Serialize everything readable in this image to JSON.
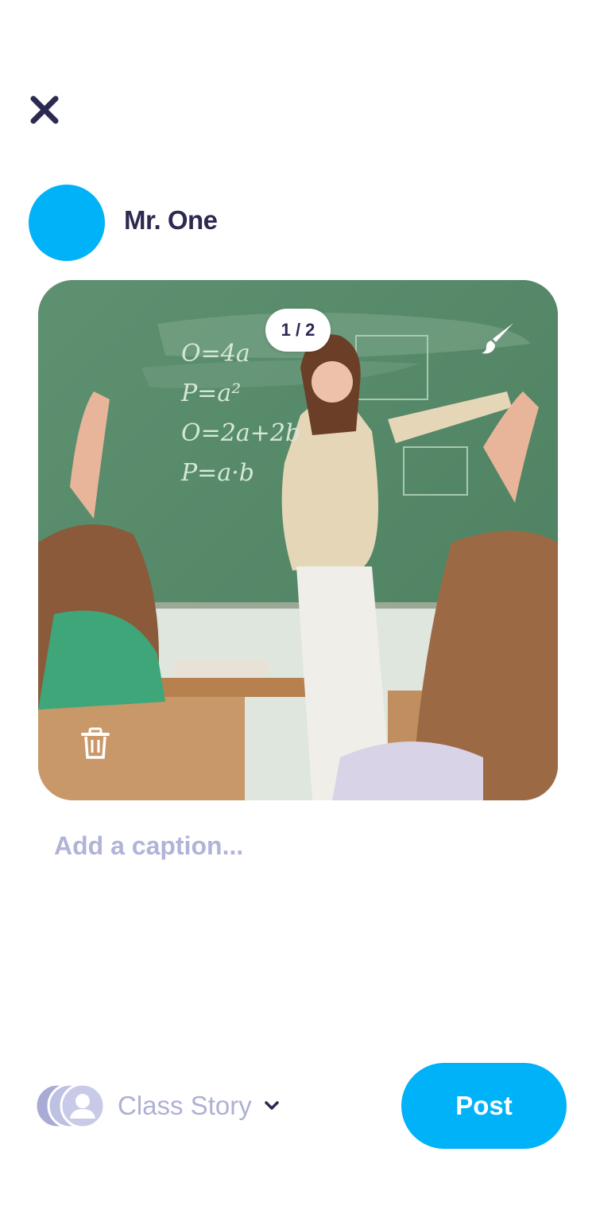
{
  "header": {
    "close_icon": "close-icon"
  },
  "post": {
    "author_name": "Mr. One",
    "avatar_color": "#00b2f7",
    "photo": {
      "counter": "1 / 2",
      "current": 1,
      "total": 2,
      "edit_icon": "paintbrush-icon",
      "delete_icon": "trash-icon",
      "chalkboard_text": [
        "O=4a",
        "P=a²",
        "O=2a+2b",
        "P=a·b"
      ]
    },
    "caption": {
      "placeholder": "Add a caption...",
      "value": ""
    }
  },
  "footer": {
    "audience_label": "Class Story",
    "audience_icon": "class-avatar-icon",
    "post_label": "Post",
    "accent_color": "#00b2f7"
  }
}
